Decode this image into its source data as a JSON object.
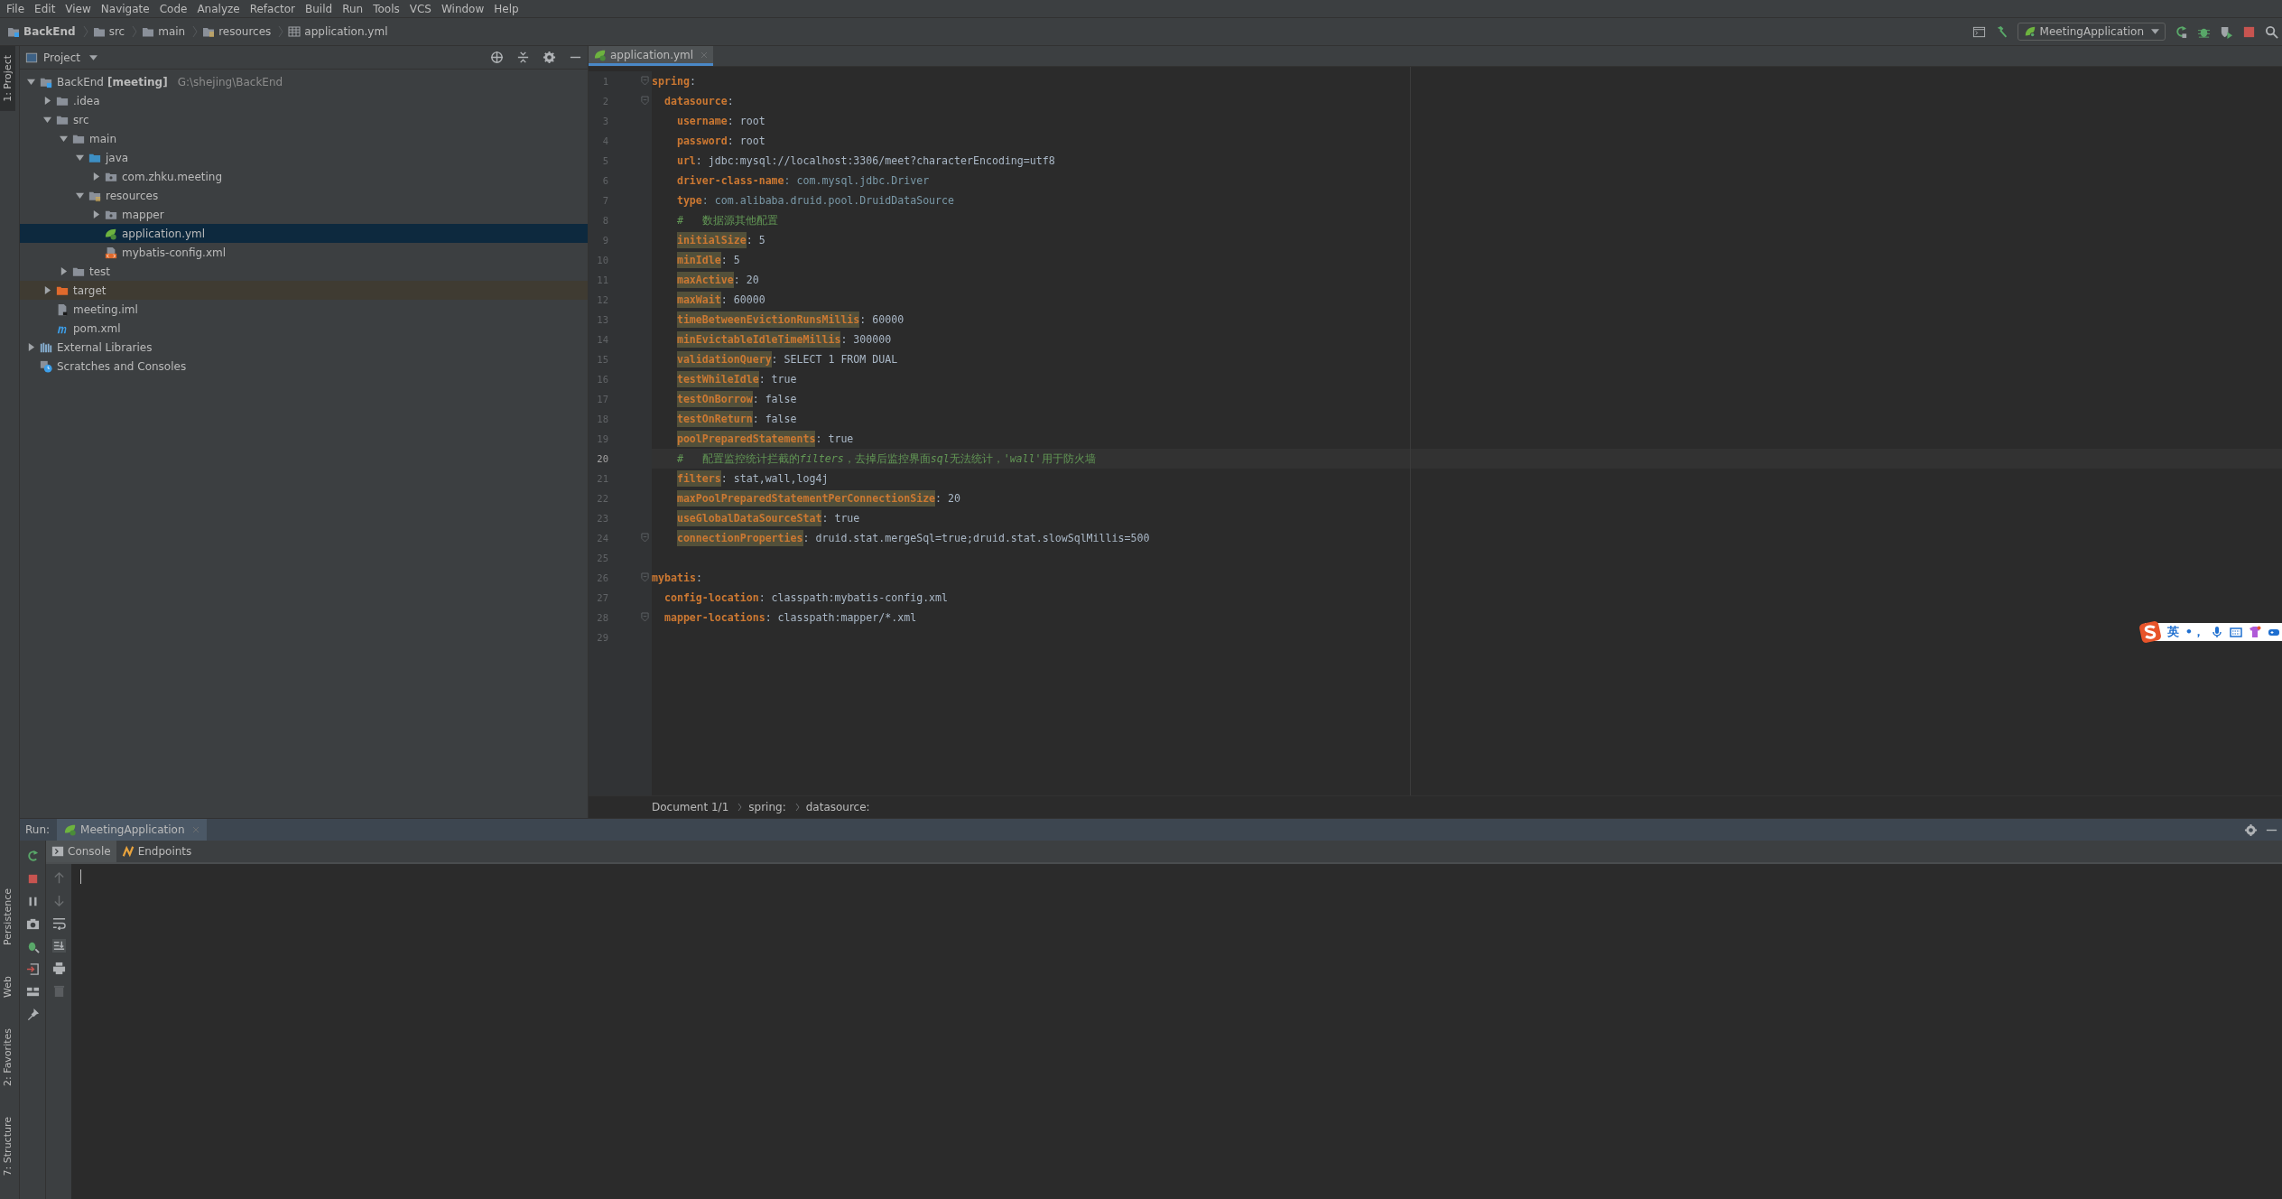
{
  "menu": [
    "File",
    "Edit",
    "View",
    "Navigate",
    "Code",
    "Analyze",
    "Refactor",
    "Build",
    "Run",
    "Tools",
    "VCS",
    "Window",
    "Help"
  ],
  "breadcrumbs": [
    {
      "label": "BackEnd",
      "kind": "module"
    },
    {
      "label": "src",
      "kind": "folder"
    },
    {
      "label": "main",
      "kind": "folder"
    },
    {
      "label": "resources",
      "kind": "resources"
    },
    {
      "label": "application.yml",
      "kind": "yml"
    }
  ],
  "run_config": {
    "label": "MeetingApplication"
  },
  "left_stripe": [
    {
      "label": "1: Project",
      "kind": "project",
      "selected": true
    },
    {
      "label": "Persistence",
      "kind": "persistence",
      "selected": false
    },
    {
      "label": "Web",
      "kind": "web",
      "selected": false
    },
    {
      "label": "2: Favorites",
      "kind": "favorites",
      "selected": false
    },
    {
      "label": "7: Structure",
      "kind": "structure",
      "selected": false
    }
  ],
  "project": {
    "title": "Project",
    "tree": [
      {
        "label": "BackEnd",
        "module": "[meeting]",
        "path": "G:\\shejing\\BackEnd",
        "kind": "module",
        "expanded": true,
        "selected": false,
        "children": [
          {
            "label": ".idea",
            "kind": "folder",
            "expanded": false,
            "selected": false
          },
          {
            "label": "src",
            "kind": "folder",
            "expanded": true,
            "selected": false,
            "children": [
              {
                "label": "main",
                "kind": "folder",
                "expanded": true,
                "selected": false,
                "children": [
                  {
                    "label": "java",
                    "kind": "source",
                    "expanded": true,
                    "selected": false,
                    "children": [
                      {
                        "label": "com.zhku.meeting",
                        "kind": "package",
                        "expanded": false,
                        "selected": false
                      }
                    ]
                  },
                  {
                    "label": "resources",
                    "kind": "resources",
                    "expanded": true,
                    "selected": false,
                    "children": [
                      {
                        "label": "mapper",
                        "kind": "package",
                        "expanded": false,
                        "selected": false
                      },
                      {
                        "label": "application.yml",
                        "kind": "yml",
                        "selected": true
                      },
                      {
                        "label": "mybatis-config.xml",
                        "kind": "xml",
                        "selected": false
                      }
                    ]
                  }
                ]
              },
              {
                "label": "test",
                "kind": "folder",
                "expanded": false,
                "selected": false
              }
            ]
          },
          {
            "label": "target",
            "kind": "excluded",
            "expanded": false,
            "selected": false
          },
          {
            "label": "meeting.iml",
            "kind": "iml",
            "selected": false
          },
          {
            "label": "pom.xml",
            "kind": "maven",
            "selected": false
          }
        ]
      },
      {
        "label": "External Libraries",
        "kind": "libraries",
        "expanded": false,
        "selected": false
      },
      {
        "label": "Scratches and Consoles",
        "kind": "scratches",
        "selected": false
      }
    ]
  },
  "editor": {
    "tab": {
      "label": "application.yml",
      "selected": true
    },
    "lines": [
      {
        "number": "1",
        "key": "spring",
        "value": {
          "text": ":",
          "kind": "plain"
        },
        "highlighted": false,
        "fold": true,
        "current": false,
        "children": [
          {
            "number": "2",
            "key": "datasource",
            "value": {
              "text": ":",
              "kind": "plain"
            },
            "highlighted": false,
            "fold": true,
            "current": false,
            "children": [
              {
                "number": "3",
                "key": "username",
                "value": {
                  "text": ": root",
                  "kind": "plain"
                },
                "highlighted": false,
                "fold": false,
                "current": false
              },
              {
                "number": "4",
                "key": "password",
                "value": {
                  "text": ": root",
                  "kind": "plain"
                },
                "highlighted": false,
                "fold": false,
                "current": false
              },
              {
                "number": "5",
                "key": "url",
                "value": {
                  "text": ": jdbc:mysql://localhost:3306/meet?characterEncoding=utf8",
                  "kind": "plain"
                },
                "highlighted": false,
                "fold": false,
                "current": false
              },
              {
                "number": "6",
                "key": "driver-class-name",
                "value": {
                  "text": ": com.mysql.jdbc.Driver",
                  "kind": "class"
                },
                "highlighted": false,
                "fold": false,
                "current": false
              },
              {
                "number": "7",
                "key": "type",
                "value": {
                  "text": ": com.alibaba.druid.pool.DruidDataSource",
                  "kind": "class"
                },
                "highlighted": false,
                "fold": false,
                "current": false
              },
              {
                "number": "8",
                "comment": [
                  {
                    "text": "#   数据源其他配置",
                    "italic": false
                  }
                ],
                "fold": false,
                "current": false
              },
              {
                "number": "9",
                "key": "initialSize",
                "value": {
                  "text": ": 5",
                  "kind": "plain"
                },
                "highlighted": true,
                "fold": false,
                "current": false
              },
              {
                "number": "10",
                "key": "minIdle",
                "value": {
                  "text": ": 5",
                  "kind": "plain"
                },
                "highlighted": true,
                "fold": false,
                "current": false
              },
              {
                "number": "11",
                "key": "maxActive",
                "value": {
                  "text": ": 20",
                  "kind": "plain"
                },
                "highlighted": true,
                "fold": false,
                "current": false
              },
              {
                "number": "12",
                "key": "maxWait",
                "value": {
                  "text": ": 60000",
                  "kind": "plain"
                },
                "highlighted": true,
                "fold": false,
                "current": false
              },
              {
                "number": "13",
                "key": "timeBetweenEvictionRunsMillis",
                "value": {
                  "text": ": 60000",
                  "kind": "plain"
                },
                "highlighted": true,
                "fold": false,
                "current": false
              },
              {
                "number": "14",
                "key": "minEvictableIdleTimeMillis",
                "value": {
                  "text": ": 300000",
                  "kind": "plain"
                },
                "highlighted": true,
                "fold": false,
                "current": false
              },
              {
                "number": "15",
                "key": "validationQuery",
                "value": {
                  "text": ": SELECT 1 FROM DUAL",
                  "kind": "plain"
                },
                "highlighted": true,
                "fold": false,
                "current": false
              },
              {
                "number": "16",
                "key": "testWhileIdle",
                "value": {
                  "text": ": true",
                  "kind": "plain"
                },
                "highlighted": true,
                "fold": false,
                "current": false
              },
              {
                "number": "17",
                "key": "testOnBorrow",
                "value": {
                  "text": ": false",
                  "kind": "plain"
                },
                "highlighted": true,
                "fold": false,
                "current": false
              },
              {
                "number": "18",
                "key": "testOnReturn",
                "value": {
                  "text": ": false",
                  "kind": "plain"
                },
                "highlighted": true,
                "fold": false,
                "current": false
              },
              {
                "number": "19",
                "key": "poolPreparedStatements",
                "value": {
                  "text": ": true",
                  "kind": "plain"
                },
                "highlighted": true,
                "fold": false,
                "current": false
              },
              {
                "number": "20",
                "comment": [
                  {
                    "text": "#   配置监控统计拦截的",
                    "italic": false
                  },
                  {
                    "text": "filters",
                    "italic": true
                  },
                  {
                    "text": "，去掉后监控界面",
                    "italic": false
                  },
                  {
                    "text": "sql",
                    "italic": true
                  },
                  {
                    "text": "无法统计，",
                    "italic": false
                  },
                  {
                    "text": "'wall'",
                    "italic": true
                  },
                  {
                    "text": "用于防火墙",
                    "italic": false
                  }
                ],
                "fold": false,
                "current": true
              },
              {
                "number": "21",
                "key": "filters",
                "value": {
                  "text": ": stat,wall,log4j",
                  "kind": "plain"
                },
                "highlighted": true,
                "fold": false,
                "current": false
              },
              {
                "number": "22",
                "key": "maxPoolPreparedStatementPerConnectionSize",
                "value": {
                  "text": ": 20",
                  "kind": "plain"
                },
                "highlighted": true,
                "fold": false,
                "current": false
              },
              {
                "number": "23",
                "key": "useGlobalDataSourceStat",
                "value": {
                  "text": ": true",
                  "kind": "plain"
                },
                "highlighted": true,
                "fold": false,
                "current": false
              },
              {
                "number": "24",
                "key": "connectionProperties",
                "value": {
                  "text": ": druid.stat.mergeSql=true;druid.stat.slowSqlMillis=500",
                  "kind": "plain"
                },
                "highlighted": true,
                "fold": true,
                "current": false
              }
            ]
          }
        ]
      },
      {
        "number": "25",
        "fold": false,
        "current": false
      },
      {
        "number": "26",
        "key": "mybatis",
        "value": {
          "text": ":",
          "kind": "plain"
        },
        "highlighted": false,
        "fold": true,
        "current": false,
        "children": [
          {
            "number": "27",
            "key": "config-location",
            "value": {
              "text": ": classpath:mybatis-config.xml",
              "kind": "plain"
            },
            "highlighted": false,
            "fold": false,
            "current": false
          },
          {
            "number": "28",
            "key": "mapper-locations",
            "value": {
              "text": ": classpath:mapper/*.xml",
              "kind": "plain"
            },
            "highlighted": false,
            "fold": true,
            "current": false
          }
        ]
      },
      {
        "number": "29",
        "fold": false,
        "current": false
      }
    ],
    "breadcrumb": [
      "Document 1/1",
      "spring:",
      "datasource:"
    ]
  },
  "run": {
    "title": "Run:",
    "tab": {
      "label": "MeetingApplication",
      "selected": true
    },
    "subtabs": [
      {
        "label": "Console",
        "kind": "console",
        "selected": true
      },
      {
        "label": "Endpoints",
        "kind": "endpoints",
        "selected": false
      }
    ]
  },
  "ime_bar": {
    "language": "英",
    "punctuation": "•，"
  }
}
